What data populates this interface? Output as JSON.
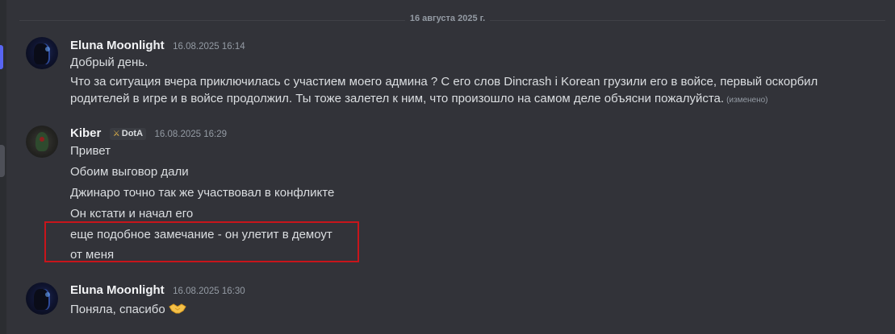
{
  "date_divider": "16 августа 2025 г.",
  "messages": [
    {
      "author": "Eluna Moonlight",
      "timestamp": "16.08.2025 16:14",
      "lines": [
        "Добрый день.",
        "Что за ситуация вчера приключилась с участием моего админа ? С его слов Dincrash i Korean грузили его в войсе, первый оскорбил",
        "родителей в игре и в войсе продолжил. Ты тоже залетел к ним, что произошло на самом деле объясни пожалуйста."
      ],
      "edited_label": "(изменено)"
    },
    {
      "author": "Kiber",
      "tag": "DotA",
      "timestamp": "16.08.2025 16:29",
      "lines": [
        "Привет",
        "Обоим выговор дали",
        "Джинаро точно так же участвовал в конфликте",
        "Он кстати и начал его",
        "еще подобное замечание - он улетит в демоут",
        "от меня"
      ]
    },
    {
      "author": "Eluna Moonlight",
      "timestamp": "16.08.2025 16:30",
      "lines": [
        "Поняла, спасибо"
      ],
      "emoji": "handshake-emoji"
    }
  ],
  "colors": {
    "background": "#323339",
    "highlight_border": "#c8151b",
    "accent": "#5865f2"
  }
}
